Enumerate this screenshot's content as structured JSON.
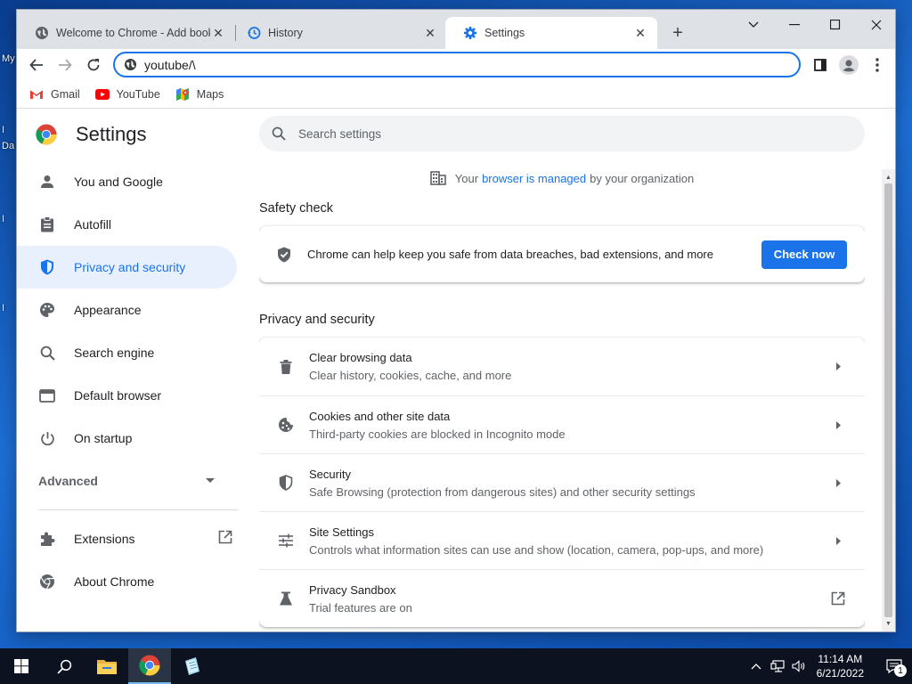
{
  "desktop": {
    "labels": [
      "My",
      "I",
      "Da",
      "I",
      "I"
    ]
  },
  "tabs": [
    {
      "title": "Welcome to Chrome - Add book",
      "icon": "globe-icon"
    },
    {
      "title": "History",
      "icon": "history-icon"
    },
    {
      "title": "Settings",
      "icon": "gear-icon"
    }
  ],
  "toolbar": {
    "url": "youtube/\\"
  },
  "bookmarks": [
    {
      "label": "Gmail",
      "icon": "gmail-icon"
    },
    {
      "label": "YouTube",
      "icon": "youtube-icon"
    },
    {
      "label": "Maps",
      "icon": "maps-icon"
    }
  ],
  "settings": {
    "title": "Settings",
    "search_placeholder": "Search settings",
    "nav": [
      {
        "label": "You and Google",
        "icon": "person-icon"
      },
      {
        "label": "Autofill",
        "icon": "clipboard-icon"
      },
      {
        "label": "Privacy and security",
        "icon": "shield-icon"
      },
      {
        "label": "Appearance",
        "icon": "palette-icon"
      },
      {
        "label": "Search engine",
        "icon": "search-icon"
      },
      {
        "label": "Default browser",
        "icon": "browser-icon"
      },
      {
        "label": "On startup",
        "icon": "power-icon"
      }
    ],
    "advanced": "Advanced",
    "extensions": "Extensions",
    "about": "About Chrome",
    "managed": {
      "pre": "Your",
      "link": "browser is managed",
      "post": "by your organization"
    },
    "safety_check": {
      "title": "Safety check",
      "text": "Chrome can help keep you safe from data breaches, bad extensions, and more",
      "button": "Check now"
    },
    "privacy": {
      "title": "Privacy and security",
      "rows": [
        {
          "title": "Clear browsing data",
          "sub": "Clear history, cookies, cache, and more",
          "icon": "trash-icon"
        },
        {
          "title": "Cookies and other site data",
          "sub": "Third-party cookies are blocked in Incognito mode",
          "icon": "cookie-icon"
        },
        {
          "title": "Security",
          "sub": "Safe Browsing (protection from dangerous sites) and other security settings",
          "icon": "shield-outline-icon"
        },
        {
          "title": "Site Settings",
          "sub": "Controls what information sites can use and show (location, camera, pop-ups, and more)",
          "icon": "sliders-icon"
        },
        {
          "title": "Privacy Sandbox",
          "sub": "Trial features are on",
          "icon": "flask-icon"
        }
      ]
    }
  },
  "taskbar": {
    "time": "11:14 AM",
    "date": "6/21/2022",
    "notifications": "1"
  }
}
